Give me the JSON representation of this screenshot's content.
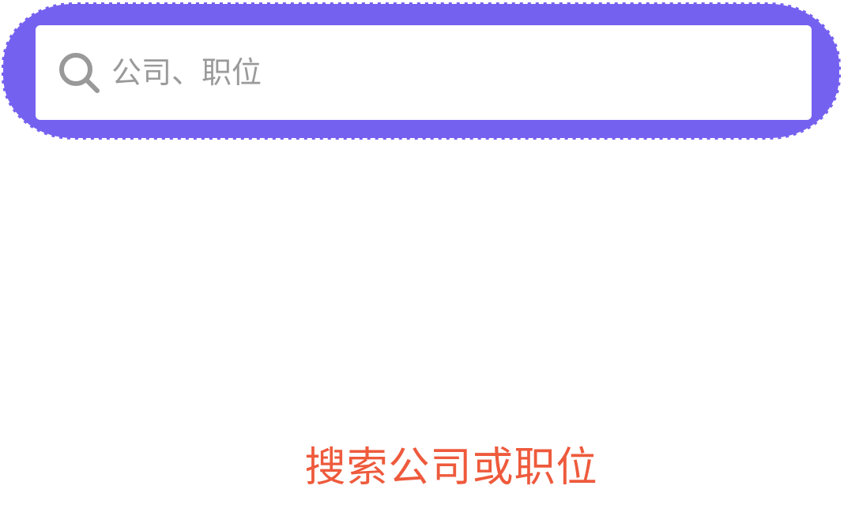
{
  "search": {
    "placeholder": "公司、职位",
    "value": "",
    "icon": "search-icon"
  },
  "hint": {
    "text": "搜索公司或职位"
  },
  "colors": {
    "bar_background": "#7561f0",
    "hint_text": "#ee5a3c",
    "icon": "#999999",
    "placeholder": "#9a9a9a"
  }
}
